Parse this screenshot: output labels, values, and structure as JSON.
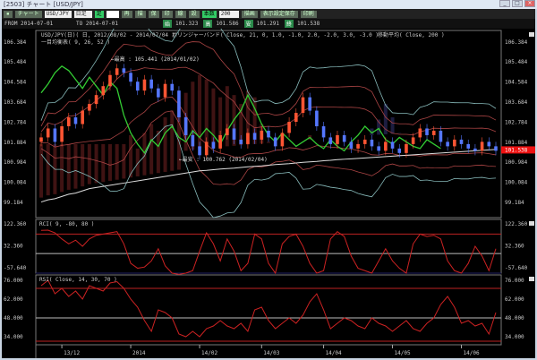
{
  "window": {
    "title": "[2503] チャート [USD/JPY]"
  },
  "toolbar": {
    "chart_btn": "チャート",
    "symbol": "USD/JPY",
    "period": "日足",
    "mark": "足",
    "count_label": "本数",
    "count": "200",
    "buttons": [
      "再",
      "描",
      "保",
      "印",
      "線",
      "設"
    ],
    "redraw": "描画",
    "settings": "表示設定保存",
    "print": "印刷"
  },
  "quote": {
    "from": "FROM 2014-07-01",
    "to": "TO  2014-07-01",
    "open_label": "始",
    "open": "101.323",
    "high_label": "高",
    "high": "101.586",
    "low_label": "安",
    "low": "101.291",
    "close_label": "終",
    "close": "101.538"
  },
  "legend": {
    "main": "USD/JPY(日)( 日, 2012/08/02 - 2014/07/04 )",
    "bollinger": "ボリンジャーバンド( Close, 21, 0, 1.0, -1.0, 2.0, -2.0, 3.0, -3.0 )",
    "sma": "移動平均( Close, 200 )",
    "ichimoku": "一目均衡表( 9, 26, 52 )",
    "rci": "RCI( 9, -80, 80 )",
    "rsi": "RSI( Close, 14, 30, 70 )"
  },
  "annotations": {
    "high": "←最高 : 105.441 (2014/01/02)",
    "low": "←最安 : 100.762 (2014/02/04)"
  },
  "colors": {
    "up": "#ff5533",
    "down": "#5577ff",
    "rsi": "#cc2222",
    "green": "#33cc33",
    "band": "#88bbbb",
    "price_marker": "#ee1111"
  },
  "chart_data": {
    "type": "candlestick",
    "price_axis": {
      "ticks": [
        "106.384",
        "105.484",
        "104.584",
        "103.684",
        "102.784",
        "101.884",
        "100.984",
        "100.084",
        "99.184"
      ],
      "range": [
        98.5,
        106.9
      ]
    },
    "last_price": "101.538",
    "x_labels": [
      "13/12",
      "2014",
      "14/02",
      "14/03",
      "14/04",
      "14/05",
      "14/06"
    ],
    "x_label_index": [
      3,
      13,
      23,
      32,
      41,
      51,
      61
    ],
    "closes": [
      102.1,
      102.5,
      101.9,
      102.6,
      103.0,
      102.7,
      103.3,
      103.6,
      104.0,
      104.4,
      104.9,
      105.2,
      105.0,
      104.6,
      104.2,
      104.7,
      104.3,
      103.9,
      104.5,
      104.2,
      103.0,
      102.2,
      101.7,
      101.3,
      101.9,
      101.6,
      102.2,
      102.5,
      102.0,
      101.8,
      102.3,
      102.0,
      102.4,
      102.1,
      101.7,
      102.3,
      102.8,
      103.2,
      103.9,
      103.3,
      102.6,
      102.1,
      101.8,
      102.2,
      101.9,
      101.6,
      101.8,
      102.0,
      101.7,
      101.5,
      101.9,
      101.6,
      101.4,
      101.8,
      102.1,
      102.5,
      102.2,
      102.4,
      101.9,
      101.7,
      102.0,
      101.8,
      101.6,
      101.5,
      101.9,
      101.7,
      101.5
    ],
    "sma200": [
      99.2,
      99.3,
      99.35,
      99.45,
      99.55,
      99.6,
      99.7,
      99.8,
      99.85,
      99.9,
      99.95,
      100.0,
      100.05,
      100.1,
      100.15,
      100.2,
      100.25,
      100.3,
      100.35,
      100.4,
      100.45,
      100.5,
      100.55,
      100.6,
      100.62,
      100.65,
      100.68,
      100.7,
      100.72,
      100.75,
      100.78,
      100.8,
      100.82,
      100.85,
      100.88,
      100.9,
      100.92,
      100.95,
      100.98,
      101.0,
      101.02,
      101.05,
      101.07,
      101.1,
      101.12,
      101.14,
      101.16,
      101.18,
      101.2,
      101.22,
      101.24,
      101.26,
      101.28,
      101.3,
      101.32,
      101.34,
      101.36,
      101.38,
      101.4,
      101.42,
      101.44,
      101.46,
      101.48,
      101.5,
      101.52,
      101.54,
      101.56
    ],
    "rci": {
      "ticks": [
        "122.360",
        "32.360",
        "-57.640"
      ],
      "range": [
        -80,
        140
      ],
      "levels": [
        80,
        0,
        -80
      ],
      "values": [
        95,
        96,
        85,
        60,
        40,
        55,
        30,
        60,
        75,
        80,
        85,
        90,
        40,
        -40,
        -60,
        -55,
        -30,
        20,
        -50,
        -80,
        -85,
        -80,
        -70,
        10,
        85,
        40,
        -30,
        60,
        10,
        -70,
        -40,
        80,
        60,
        -40,
        -80,
        40,
        70,
        80,
        30,
        -40,
        -80,
        -70,
        60,
        90,
        70,
        -10,
        -60,
        -70,
        -80,
        -30,
        20,
        -30,
        -60,
        -80,
        40,
        80,
        70,
        75,
        60,
        -30,
        -70,
        -80,
        -40,
        30,
        -10,
        -70,
        20
      ]
    },
    "rsi": {
      "ticks": [
        "76.000",
        "62.000",
        "48.000",
        "34.000"
      ],
      "range": [
        28,
        80
      ],
      "levels": [
        70,
        48
      ],
      "values": [
        72,
        76,
        66,
        70,
        64,
        68,
        62,
        72,
        70,
        68,
        74,
        75,
        70,
        62,
        56,
        46,
        38,
        54,
        52,
        48,
        36,
        34,
        38,
        34,
        40,
        42,
        46,
        42,
        40,
        44,
        38,
        54,
        56,
        46,
        40,
        44,
        48,
        44,
        50,
        60,
        66,
        54,
        40,
        44,
        48,
        46,
        42,
        40,
        48,
        44,
        42,
        38,
        42,
        46,
        40,
        38,
        44,
        48,
        58,
        64,
        56,
        44,
        46,
        42,
        44,
        36,
        52
      ]
    }
  }
}
